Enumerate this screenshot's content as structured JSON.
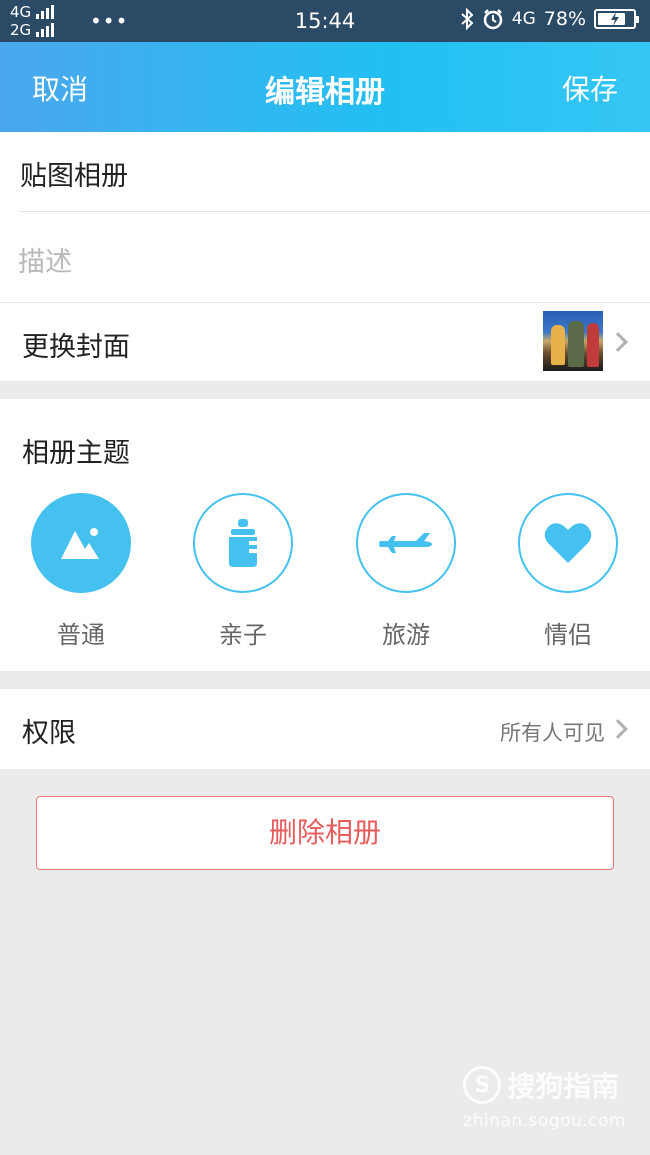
{
  "status_bar": {
    "net1": "4G",
    "net2": "2G",
    "dots": "•••",
    "time": "15:44",
    "net3": "4G",
    "battery": "78%",
    "battery_level": 0.78
  },
  "nav": {
    "cancel": "取消",
    "title": "编辑相册",
    "save": "保存"
  },
  "album": {
    "name": "贴图相册",
    "desc_placeholder": "描述"
  },
  "cover": {
    "label": "更换封面"
  },
  "themes": {
    "title": "相册主题",
    "items": [
      {
        "label": "普通",
        "icon": "mountain-photo-icon",
        "selected": true
      },
      {
        "label": "亲子",
        "icon": "baby-bottle-icon",
        "selected": false
      },
      {
        "label": "旅游",
        "icon": "airplane-icon",
        "selected": false
      },
      {
        "label": "情侣",
        "icon": "heart-icon",
        "selected": false
      }
    ]
  },
  "permission": {
    "label": "权限",
    "value": "所有人可见"
  },
  "delete_label": "删除相册",
  "watermark": {
    "brand": "搜狗指南",
    "url": "zhinan.sogou.com"
  },
  "colors": {
    "accent": "#45c1f0",
    "danger": "#e85c5c"
  }
}
